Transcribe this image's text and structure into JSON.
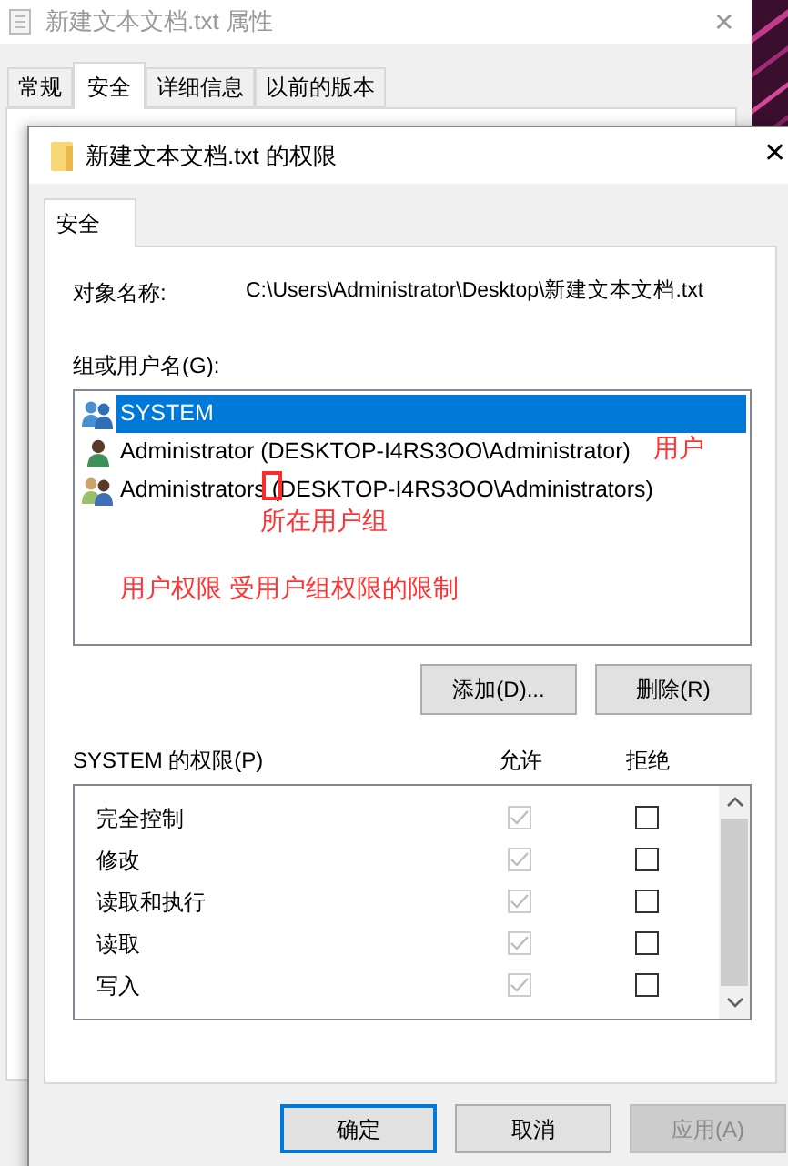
{
  "background_window": {
    "title": "新建文本文档.txt 属性",
    "close": "✕",
    "tabs": [
      {
        "label": "常规",
        "selected": false
      },
      {
        "label": "安全",
        "selected": true
      },
      {
        "label": "详细信息",
        "selected": false
      },
      {
        "label": "以前的版本",
        "selected": false
      }
    ]
  },
  "dialog": {
    "title": "新建文本文档.txt 的权限",
    "close": "✕",
    "tabs": [
      {
        "label": "安全",
        "selected": true
      }
    ],
    "object_name_label": "对象名称:",
    "object_name": "C:\\Users\\Administrator\\Desktop\\新建文本文档.txt",
    "users_label": "组或用户名(G):",
    "users": [
      {
        "name": "SYSTEM",
        "kind": "group",
        "selected": true
      },
      {
        "name": "Administrator (DESKTOP-I4RS3OO\\Administrator)",
        "kind": "user",
        "selected": false
      },
      {
        "name": "Administrators (DESKTOP-I4RS3OO\\Administrators)",
        "kind": "admins",
        "selected": false
      }
    ],
    "user_buttons": [
      "添加(D)...",
      "删除(R)"
    ],
    "permissions_label": "SYSTEM 的权限(P)",
    "columns": [
      "允许",
      "拒绝"
    ],
    "permissions": [
      {
        "name": "完全控制",
        "allow": {
          "checked": true,
          "disabled": true
        },
        "deny": {
          "checked": false,
          "disabled": false
        }
      },
      {
        "name": "修改",
        "allow": {
          "checked": true,
          "disabled": true
        },
        "deny": {
          "checked": false,
          "disabled": false
        }
      },
      {
        "name": "读取和执行",
        "allow": {
          "checked": true,
          "disabled": true
        },
        "deny": {
          "checked": false,
          "disabled": false
        }
      },
      {
        "name": "读取",
        "allow": {
          "checked": true,
          "disabled": true
        },
        "deny": {
          "checked": false,
          "disabled": false
        }
      },
      {
        "name": "写入",
        "allow": {
          "checked": true,
          "disabled": true
        },
        "deny": {
          "checked": false,
          "disabled": false
        }
      }
    ],
    "buttons": [
      {
        "label": "确定",
        "focused": true,
        "disabled": false
      },
      {
        "label": "取消",
        "focused": false,
        "disabled": false
      },
      {
        "label": "应用(A)",
        "focused": false,
        "disabled": true
      }
    ]
  },
  "annotations": [
    {
      "kind": "text",
      "text": "用户"
    },
    {
      "kind": "box"
    },
    {
      "kind": "text",
      "text": "所在用户组"
    },
    {
      "kind": "text",
      "text": "用户权限 受用户组权限的限制"
    }
  ]
}
